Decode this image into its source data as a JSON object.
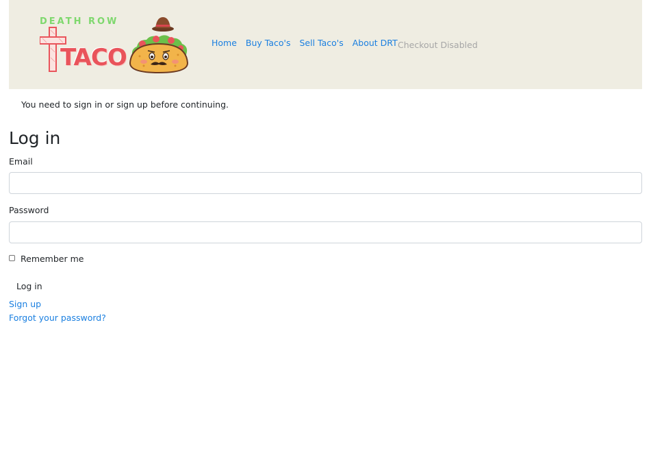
{
  "brand": {
    "top_text": "DEATH ROW",
    "main_text": "TACO",
    "colors": {
      "green": "#7ed86d",
      "red": "#e9545b",
      "taco_shell": "#f2b44a",
      "lettuce": "#6cc04a",
      "hat": "#8a4b2c"
    }
  },
  "nav": {
    "links": [
      {
        "label": "Home"
      },
      {
        "label": "Buy Taco's"
      },
      {
        "label": "Sell Taco's"
      },
      {
        "label": "About DRT"
      }
    ],
    "disabled_label": "Checkout Disabled",
    "link_color": "#1a7fe0",
    "background": "#efede2"
  },
  "notice": {
    "text": "You need to sign in or sign up before continuing."
  },
  "login": {
    "title": "Log in",
    "email_label": "Email",
    "email_value": "",
    "password_label": "Password",
    "password_value": "",
    "remember_label": "Remember me",
    "remember_checked": false,
    "submit_label": "Log in",
    "signup_link": "Sign up",
    "forgot_link": "Forgot your password?"
  }
}
